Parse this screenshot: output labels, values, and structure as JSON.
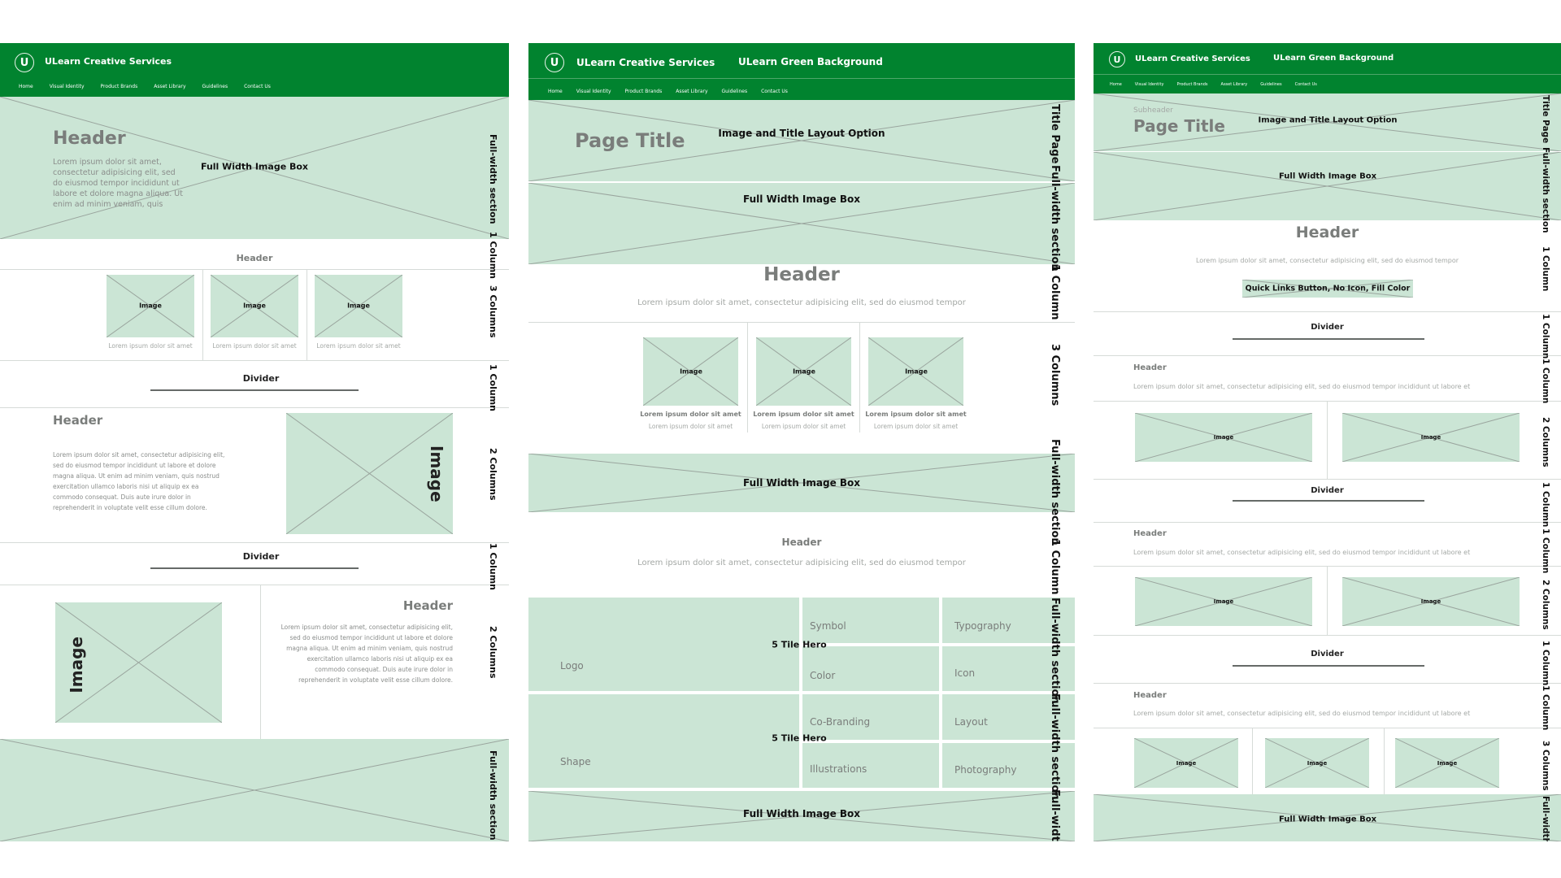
{
  "colors": {
    "brand_green": "#01832f",
    "placeholder_fill": "#cbe5d5",
    "text_grey": "#7a7d7b"
  },
  "common": {
    "logo_letter": "U",
    "site_name": "ULearn Creative Services",
    "bg_label": "ULearn Green Background",
    "nav": [
      "Home",
      "Visual Identity",
      "Product Brands",
      "Asset Library",
      "Guidelines",
      "Contact Us"
    ],
    "lorem_short": "Lorem ipsum dolor sit amet",
    "lorem_line": "Lorem ipsum dolor sit amet, consectetur adipisicing elit, sed do eiusmod tempor",
    "lorem_line_long": "Lorem ipsum dolor sit amet, consectetur adipisicing elit, sed do eiusmod tempor incididunt ut labore et",
    "lorem_block": "Lorem ipsum dolor sit amet, consectetur adipisicing elit, sed do eiusmod tempor incididunt ut labore et dolore magna aliqua. Ut enim ad minim veniam, quis nostrud exercitation ullamco laboris nisi ut aliquip ex ea commodo consequat. Duis aute irure dolor in reprehenderit in voluptate velit esse cillum dolore.",
    "image": "Image",
    "header": "Header",
    "divider": "Divider",
    "full_width_image_box": "Full Width Image Box"
  },
  "panel1": {
    "hero_header": "Header",
    "hero_text": "Lorem ipsum dolor sit amet, consectetur adipisicing elit, sed do eiusmod tempor incididunt ut labore et dolore magna aliqua. Ut enim ad minim veniam, quis",
    "section_labels": [
      "Full-width section",
      "1 Column",
      "3 Columns",
      "1 Column",
      "2 Columns",
      "1 Column",
      "2 Columns",
      "Full-width section"
    ]
  },
  "panel2": {
    "page_title": "Page Title",
    "title_option": "Image and Title Layout Option",
    "tile_hero": "5 Tile Hero",
    "tiles_row1": [
      "Logo",
      "Symbol",
      "Typography",
      "Color",
      "Icon"
    ],
    "tiles_row2": [
      "Shape",
      "Co-Branding",
      "Layout",
      "Illustrations",
      "Photography"
    ],
    "section_labels": [
      "Title Page",
      "Full-width section",
      "1 Column",
      "3 Columns",
      "Full-width section",
      "1 Column",
      "Full-width section",
      "Full-width section",
      "Full-width :"
    ]
  },
  "panel3": {
    "subheader": "Subheader",
    "page_title": "Page Title",
    "title_option": "Image and Title Layout Option",
    "quick_links_button": "Quick Links Button, No Icon, Fill Color",
    "section_labels": [
      "Title Page",
      "Full-width section",
      "1 Column",
      "1 Column",
      "1 Column",
      "2 Columns",
      "1 Column",
      "1 Column",
      "2 Columns",
      "1 Column",
      "1 Column",
      "3 Columns",
      "Full-width"
    ]
  }
}
